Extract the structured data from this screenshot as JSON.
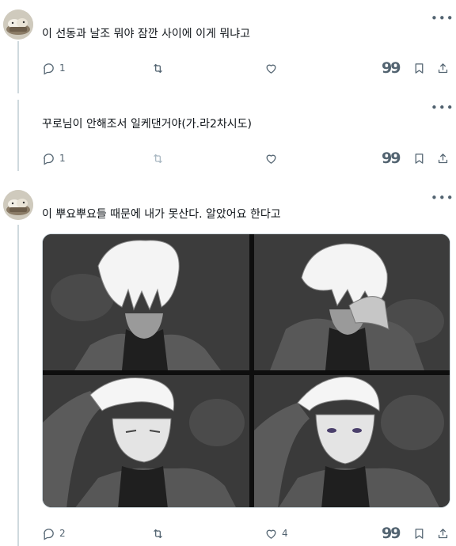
{
  "tweets": [
    {
      "text": "이 선동과 날조 뭐야 잠깐 사이에 이게 뭐냐고",
      "replies": "1",
      "retweets": "",
      "likes": "",
      "has_avatar": true
    },
    {
      "text": "꾸로님이 안해조서 일케댄거야(가.라2차시도)",
      "replies": "1",
      "retweets": "",
      "likes": "",
      "has_avatar": false
    },
    {
      "text": "이 뿌요뿌요들 때문에 내가 못산다. 알았어요 한다고",
      "replies": "2",
      "retweets": "",
      "likes": "4",
      "has_avatar": true,
      "media": "4-panel grayscale illustration of a white-haired man in a turtleneck"
    }
  ],
  "icons": {
    "more": "more-horizontal-icon",
    "reply": "reply-icon",
    "retweet": "retweet-icon",
    "like": "heart-icon",
    "quote": "quote-icon",
    "bookmark": "bookmark-icon",
    "share": "share-icon"
  },
  "colors": {
    "text": "#0f1419",
    "muted": "#536471",
    "disabled": "#aab8c2",
    "thread_line": "#cfd9de"
  }
}
